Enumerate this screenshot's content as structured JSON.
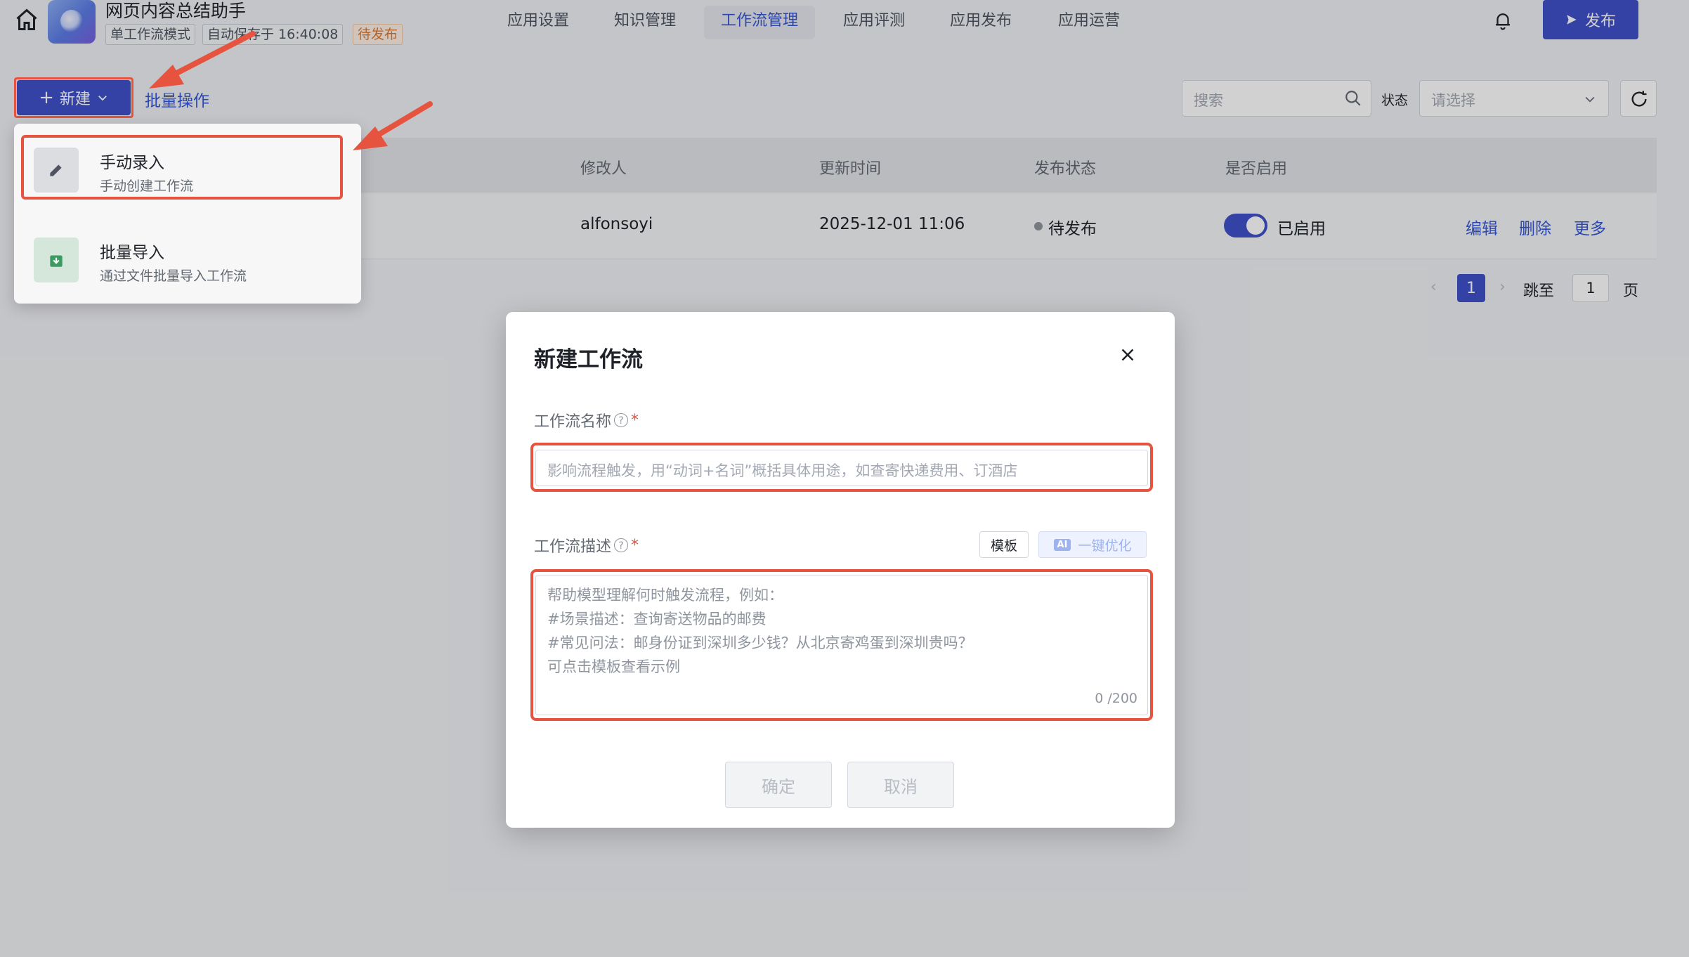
{
  "header": {
    "app_name": "网页内容总结助手",
    "tag_mode": "单工作流模式",
    "tag_autosave": "自动保存于 16:40:08",
    "tag_status": "待发布",
    "tabs": [
      {
        "label": "应用设置"
      },
      {
        "label": "知识管理"
      },
      {
        "label": "工作流管理"
      },
      {
        "label": "应用评测"
      },
      {
        "label": "应用发布"
      },
      {
        "label": "应用运营"
      }
    ],
    "publish_label": "发布"
  },
  "toolbar": {
    "new_label": "新建",
    "batch_label": "批量操作",
    "search_placeholder": "搜索",
    "status_label": "状态",
    "status_placeholder": "请选择"
  },
  "table": {
    "columns": {
      "modifier": "修改人",
      "updated": "更新时间",
      "publish_status": "发布状态",
      "enabled": "是否启用"
    },
    "rows": [
      {
        "modifier": "alfonsoyi",
        "updated": "2025-12-01 11:06",
        "status": "待发布",
        "enabled_label": "已启用",
        "actions": {
          "edit": "编辑",
          "delete": "删除",
          "more": "更多"
        }
      }
    ]
  },
  "pagination": {
    "current": "1",
    "jump_label": "跳至",
    "jump_value": "1",
    "page_label": "页"
  },
  "dropdown": {
    "items": [
      {
        "title": "手动录入",
        "subtitle": "手动创建工作流"
      },
      {
        "title": "批量导入",
        "subtitle": "通过文件批量导入工作流"
      }
    ]
  },
  "modal": {
    "title": "新建工作流",
    "name_label": "工作流名称",
    "name_placeholder": "影响流程触发，用“动词+名词”概括具体用途，如查寄快递费用、订酒店",
    "desc_label": "工作流描述",
    "template_label": "模板",
    "ai_badge": "AI",
    "ai_label": "一键优化",
    "desc_placeholder_lines": [
      "帮助模型理解何时触发流程，例如：",
      "#场景描述：查询寄送物品的邮费",
      "#常见问法：邮身份证到深圳多少钱？从北京寄鸡蛋到深圳贵吗？",
      "可点击模板查看示例"
    ],
    "counter": "0 /200",
    "confirm_label": "确定",
    "cancel_label": "取消",
    "required_mark": "*",
    "help_mark": "?"
  },
  "colors": {
    "accent": "#3f51c8",
    "annotation": "#e6533f",
    "pending": "#e0782f"
  }
}
